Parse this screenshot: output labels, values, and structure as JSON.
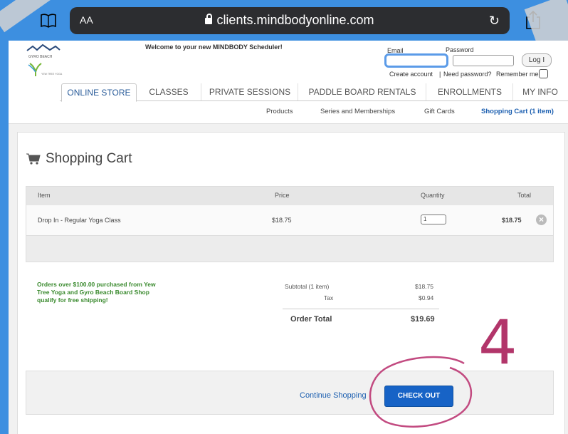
{
  "browser": {
    "text_size_label": "AA",
    "url": "clients.mindbodyonline.com",
    "reload_glyph": "↻"
  },
  "header": {
    "welcome": "Welcome to your new MINDBODY Scheduler!",
    "email_label": "Email",
    "password_label": "Password",
    "login_button": "Log I",
    "create_account": "Create account",
    "separator": "|",
    "need_password": "Need password?",
    "remember_me": "Remember me",
    "logo_text_1": "GYRO BEACH",
    "logo_text_2": "YEW TREE YOGA"
  },
  "tabs": [
    "ONLINE STORE",
    "CLASSES",
    "PRIVATE SESSIONS",
    "PADDLE BOARD RENTALS",
    "ENROLLMENTS",
    "MY INFO"
  ],
  "subnav": [
    "Products",
    "Series and Memberships",
    "Gift Cards",
    "Shopping Cart (1 item)"
  ],
  "cart": {
    "title": "Shopping Cart",
    "columns": {
      "item": "Item",
      "price": "Price",
      "quantity": "Quantity",
      "total": "Total"
    },
    "row": {
      "item": "Drop In - Regular Yoga Class",
      "price": "$18.75",
      "quantity": "1",
      "total": "$18.75",
      "remove_glyph": "×"
    },
    "promo": "Orders over $100.00 purchased from Yew Tree Yoga and Gyro Beach Board Shop qualify for free shipping!",
    "subtotal_label": "Subtotal  (1 item)",
    "subtotal_value": "$18.75",
    "tax_label": "Tax",
    "tax_value": "$0.94",
    "order_total_label": "Order Total",
    "order_total_value": "$19.69",
    "continue_label": "Continue Shopping",
    "checkout_label": "CHECK OUT"
  },
  "annotation": {
    "step_number": "4",
    "color": "#b2356a"
  },
  "colors": {
    "brand_blue": "#3d8fe0",
    "link_blue": "#1c5fb0",
    "checkout_blue": "#1763c6",
    "promo_green": "#3a8a2e"
  }
}
